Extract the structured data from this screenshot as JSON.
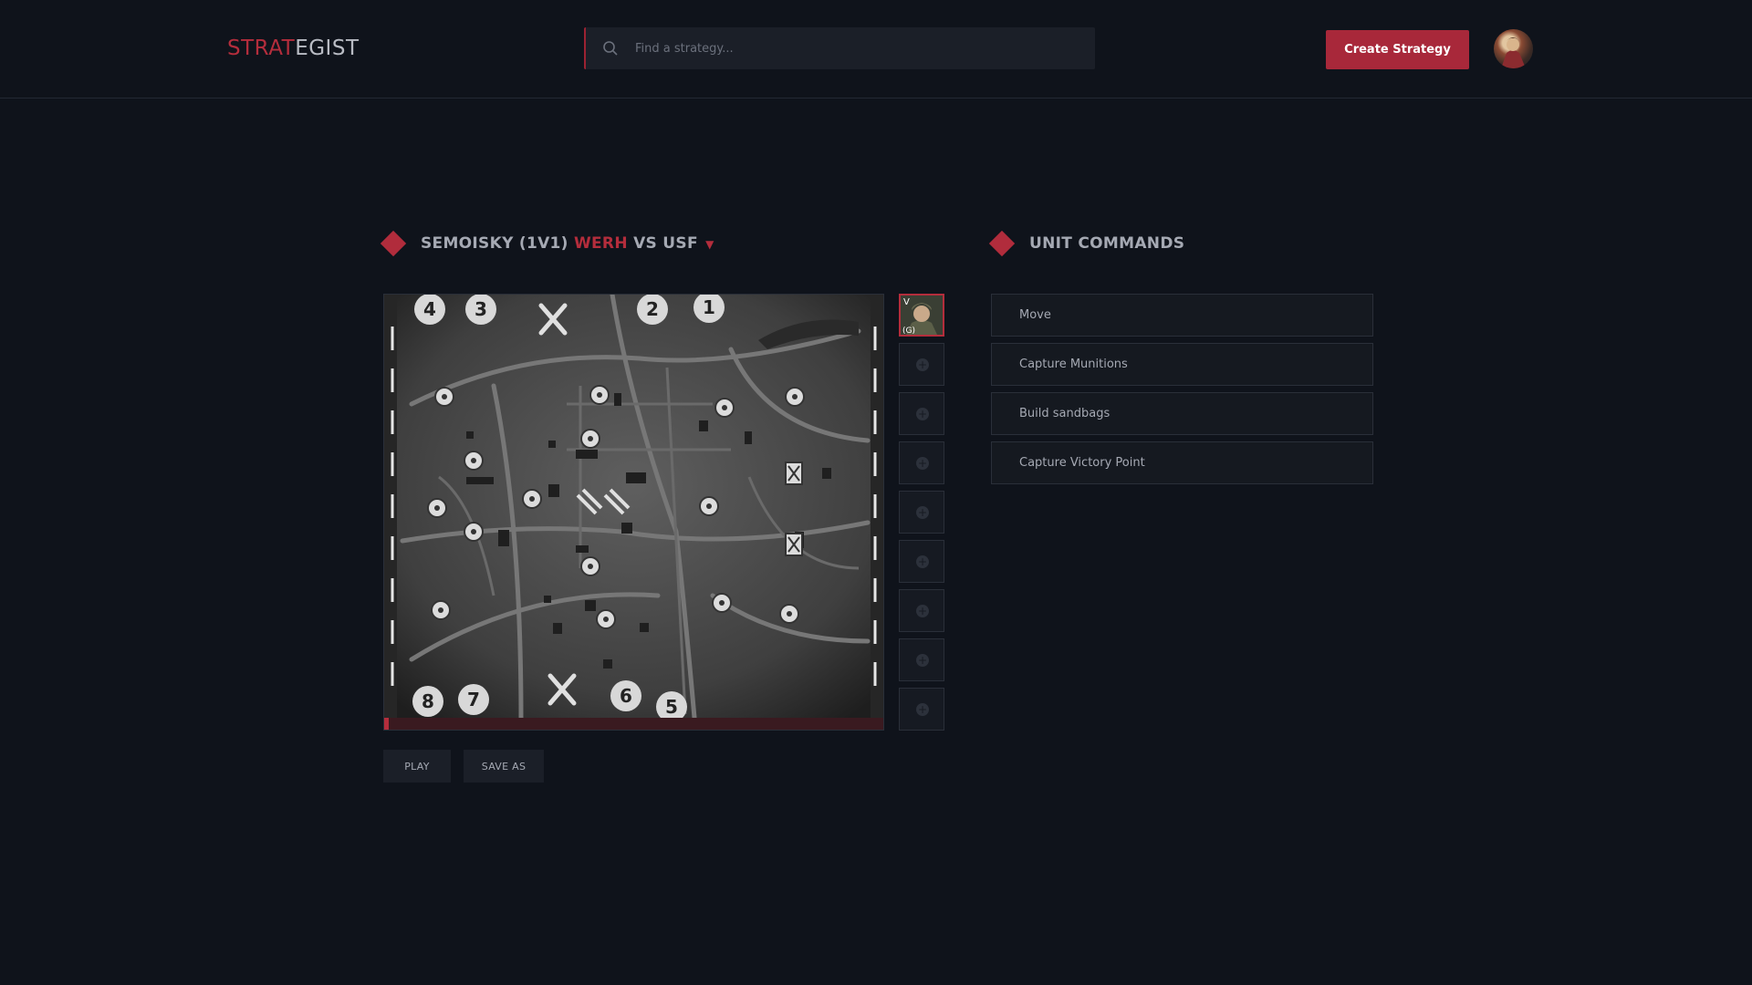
{
  "header": {
    "logo_part1": "STRAT",
    "logo_part2": "EGIST",
    "search_placeholder": "Find a strategy...",
    "create_label": "Create Strategy",
    "avatar_icon": "user-avatar"
  },
  "strategy": {
    "title_prefix": "SEMOISKY (1V1)",
    "faction_a": "WERH",
    "title_suffix": "VS USF",
    "caret": "▼",
    "play_label": "PLAY",
    "save_label": "SAVE AS",
    "timeline_progress": 0.01
  },
  "map": {
    "numbers": [
      "4",
      "3",
      "2",
      "1",
      "8",
      "7",
      "6",
      "5"
    ],
    "icon_names": [
      "repair-icon",
      "fuel-icon",
      "munitions-icon",
      "victory-point-icon"
    ]
  },
  "unit_slots": {
    "count": 9,
    "active_index": 0,
    "active_unit": "officer-unit-portrait",
    "active_unit_tag": "(G)"
  },
  "commands": {
    "title": "UNIT COMMANDS",
    "items": [
      {
        "label": "Move"
      },
      {
        "label": "Capture Munitions"
      },
      {
        "label": "Build sandbags"
      },
      {
        "label": "Capture Victory Point"
      }
    ]
  },
  "colors": {
    "accent": "#b42d3c",
    "background": "#0f131b",
    "panel": "#1b1f28"
  }
}
